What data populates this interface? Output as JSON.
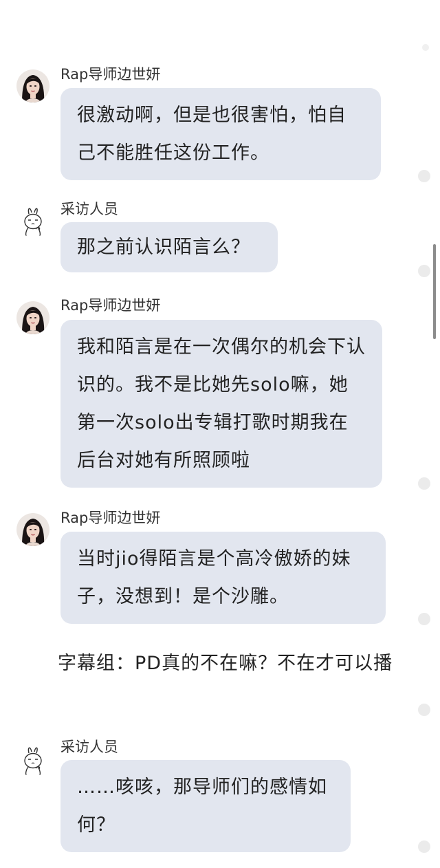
{
  "messages": [
    {
      "sender": "Rap导师边世妍",
      "avatar": "woman-portrait-avatar",
      "text": "很激动啊，但是也很害怕，怕自己不能胜任这份工作。"
    },
    {
      "sender": "采访人员",
      "avatar": "rabbit-doodle-avatar",
      "text": "那之前认识陌言么？"
    },
    {
      "sender": "Rap导师边世妍",
      "avatar": "woman-portrait-avatar",
      "text": "我和陌言是在一次偶尔的机会下认识的。我不是比她先solo嘛，她第一次solo出专辑打歌时期我在后台对她有所照顾啦"
    },
    {
      "sender": "Rap导师边世妍",
      "avatar": "woman-portrait-avatar",
      "text": "当时jio得陌言是个高冷傲娇的妹子，没想到！是个沙雕。"
    },
    {
      "sender": "采访人员",
      "avatar": "rabbit-doodle-avatar",
      "text": "……咳咳，那导师们的感情如何？"
    }
  ],
  "narration": "字幕组：PD真的不在嘛？不在才可以播",
  "colors": {
    "bubble": "#e2e6ef",
    "background": "#ffffff",
    "scrollbar": "#8c8c8c"
  }
}
